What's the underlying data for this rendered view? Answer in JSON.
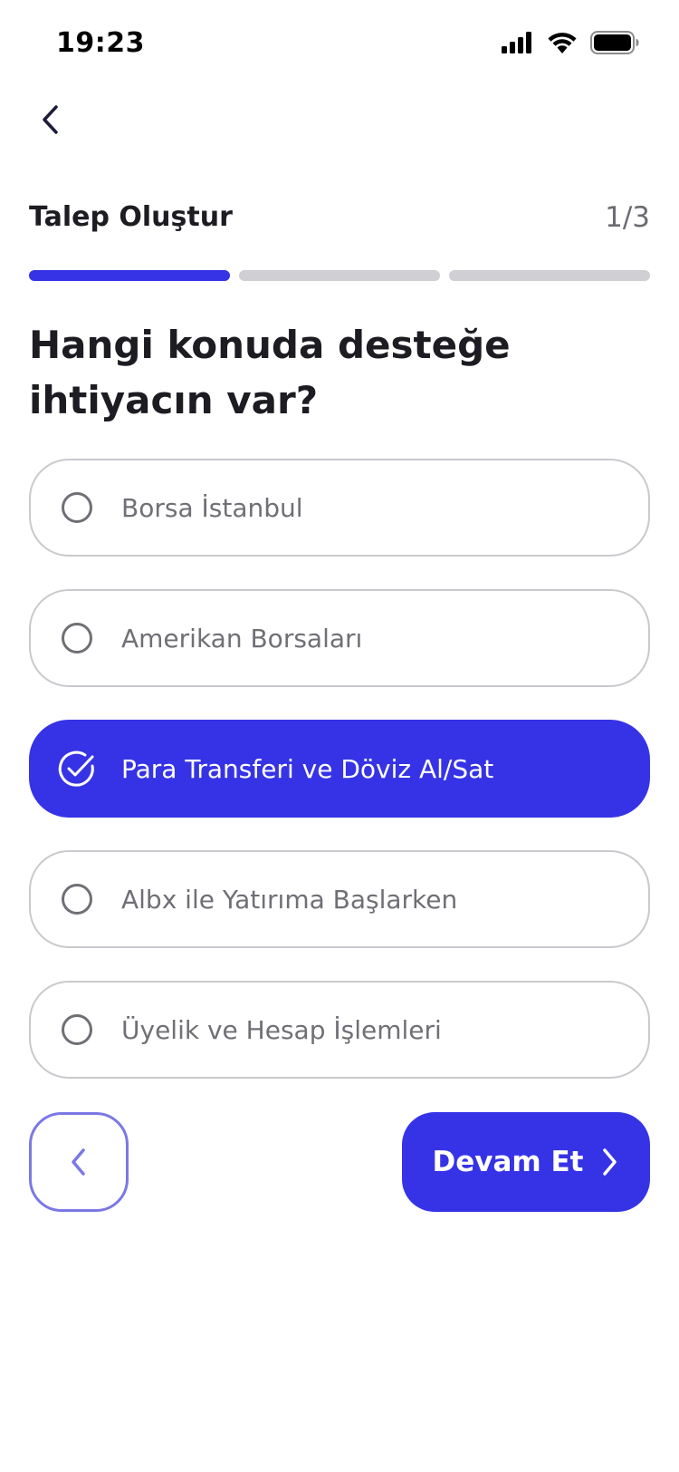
{
  "status_bar": {
    "time": "19:23",
    "icons": [
      "signal-icon",
      "wifi-icon",
      "battery-icon"
    ]
  },
  "header": {
    "back_icon": "chevron-left-icon",
    "title": "Talep Oluştur",
    "step": "1/3"
  },
  "progress": {
    "steps_total": 3,
    "steps_completed": 1,
    "active_color": "#3633e6",
    "inactive_color": "#cfcfd4"
  },
  "question": {
    "line1": "Hangi konuda desteğe",
    "line2": "ihtiyacın var?"
  },
  "options": [
    {
      "label": "Borsa İstanbul",
      "selected": false
    },
    {
      "label": "Amerikan Borsaları",
      "selected": false
    },
    {
      "label": "Para Transferi ve Döviz Al/Sat",
      "selected": true
    },
    {
      "label": "Albx ile Yatırıma Başlarken",
      "selected": false
    },
    {
      "label": "Üyelik ve Hesap İşlemleri",
      "selected": false
    }
  ],
  "buttons": {
    "previous_icon": "chevron-left-icon",
    "next_label": "Devam Et",
    "next_icon": "chevron-right-icon"
  },
  "colors": {
    "accent": "#3633e6",
    "outline_accent": "#7b78e6",
    "text_muted": "#6f6f76"
  }
}
